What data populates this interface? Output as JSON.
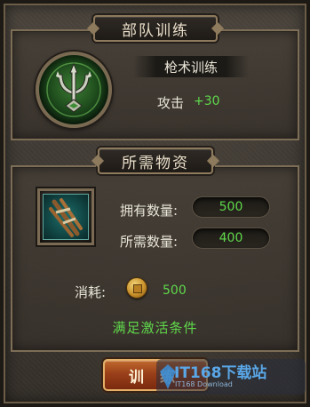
{
  "section_training": {
    "title": "部队训练"
  },
  "skill": {
    "icon": "trident-emblem-icon",
    "name": "枪术训练",
    "stat_label": "攻击",
    "stat_value": "+30"
  },
  "section_materials": {
    "title": "所需物资"
  },
  "material": {
    "icon": "spear-bundle-icon",
    "owned_label": "拥有数量:",
    "owned_value": "500",
    "required_label": "所需数量:",
    "required_value": "400"
  },
  "cost": {
    "label": "消耗:",
    "icon": "coin-icon",
    "value": "500"
  },
  "condition_text": "满足激活条件",
  "train_button": {
    "label": "训练"
  },
  "watermark": {
    "text": "IT168下载站",
    "sub": "IT168 Download"
  },
  "colors": {
    "highlight_green": "#5fd94b",
    "panel_border": "#7c6d57",
    "button_orange": "#9a3f19"
  }
}
